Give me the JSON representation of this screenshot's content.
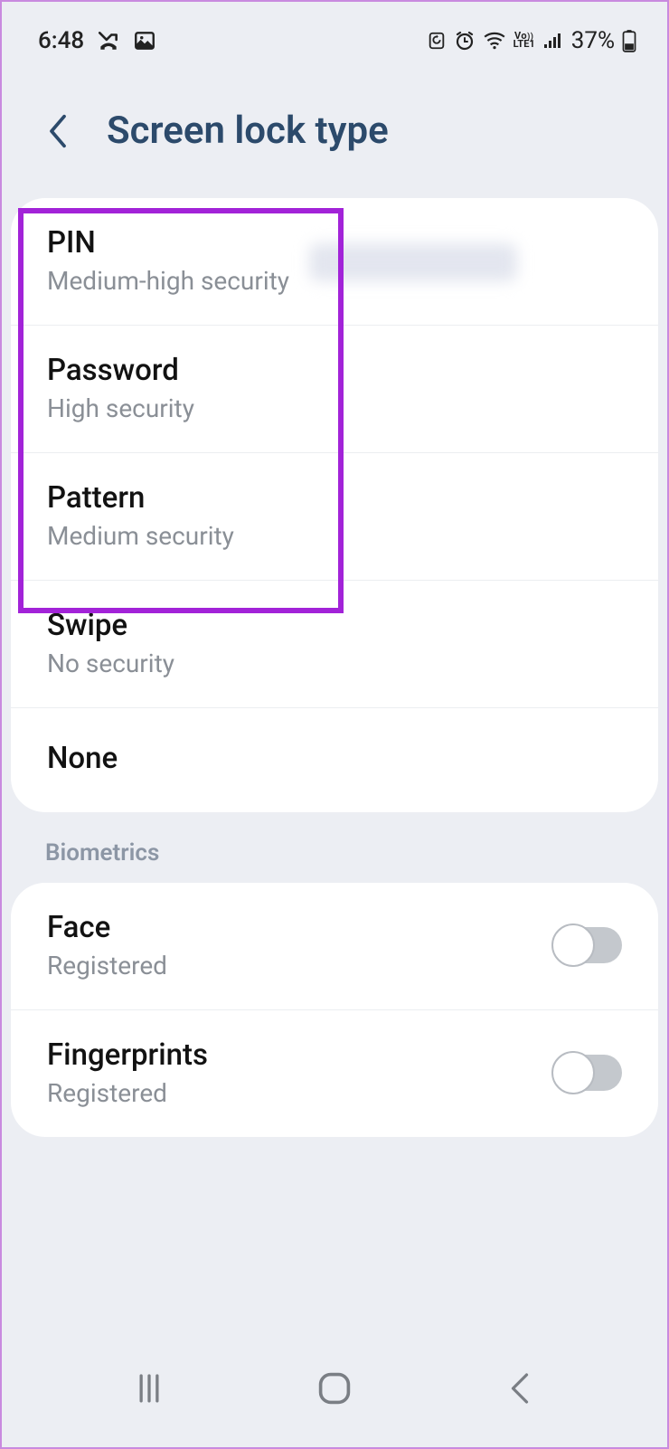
{
  "status": {
    "time": "6:48",
    "battery_pct": "37%",
    "network_label": "LTE1",
    "vo_label": "Vo"
  },
  "header": {
    "title": "Screen lock type"
  },
  "lock_options": [
    {
      "title": "PIN",
      "sub": "Medium-high security"
    },
    {
      "title": "Password",
      "sub": "High security"
    },
    {
      "title": "Pattern",
      "sub": "Medium security"
    },
    {
      "title": "Swipe",
      "sub": "No security"
    },
    {
      "title": "None",
      "sub": ""
    }
  ],
  "section_biometrics": "Biometrics",
  "biometrics": [
    {
      "title": "Face",
      "sub": "Registered",
      "on": false
    },
    {
      "title": "Fingerprints",
      "sub": "Registered",
      "on": false
    }
  ]
}
